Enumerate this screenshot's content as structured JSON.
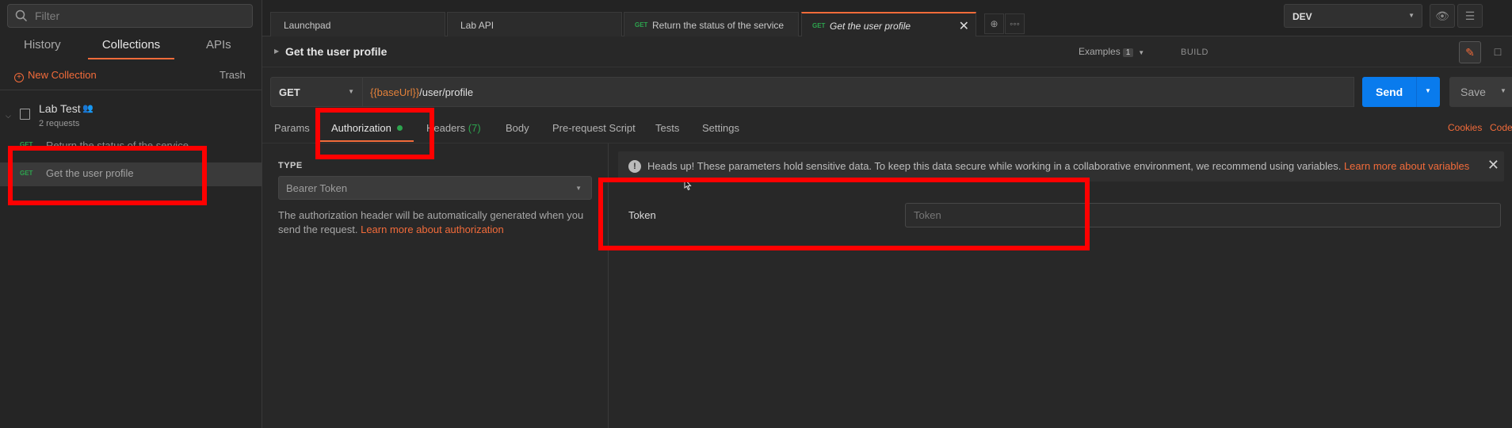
{
  "sidebar": {
    "filter_placeholder": "Filter",
    "tabs": [
      {
        "label": "History"
      },
      {
        "label": "Collections"
      },
      {
        "label": "APIs"
      }
    ],
    "new_collection": "New Collection",
    "trash": "Trash",
    "collection": {
      "name": "Lab Test",
      "meta": "2 requests",
      "requests": [
        {
          "method": "GET",
          "name": "Return the status of the service"
        },
        {
          "method": "GET",
          "name": "Get the user profile"
        }
      ]
    }
  },
  "tabs": [
    {
      "label": "Launchpad"
    },
    {
      "label": "Lab API"
    },
    {
      "method": "GET",
      "label": "Return the status of the service"
    },
    {
      "method": "GET",
      "label": "Get the user profile",
      "close": "✕"
    }
  ],
  "environment": {
    "selected": "DEV"
  },
  "request": {
    "title": "Get the user profile",
    "examples_label": "Examples",
    "examples_count": "1",
    "mode": "BUILD",
    "method": "GET",
    "url_var": "{{baseUrl}}",
    "url_path": "/user/profile",
    "send_label": "Send",
    "save_label": "Save"
  },
  "request_tabs": [
    {
      "label": "Params"
    },
    {
      "label": "Authorization"
    },
    {
      "label": "Headers",
      "count": "(7)"
    },
    {
      "label": "Body"
    },
    {
      "label": "Pre-request Script"
    },
    {
      "label": "Tests"
    },
    {
      "label": "Settings"
    }
  ],
  "cookies": "Cookies",
  "code": "Code",
  "auth": {
    "type_label": "TYPE",
    "type_value": "Bearer Token",
    "description": "The authorization header will be automatically generated when you send the request.",
    "learn_more": "Learn more about authorization",
    "alert_text": "Heads up! These parameters hold sensitive data. To keep this data secure while working in a collaborative environment, we recommend using variables.",
    "alert_link": "Learn more about variables",
    "token_label": "Token",
    "token_placeholder": "Token",
    "token_value": ""
  },
  "colors": {
    "accent": "#f26b3a",
    "send": "#097bed",
    "get_method": "#2da44e",
    "highlight": "#ff0000"
  }
}
